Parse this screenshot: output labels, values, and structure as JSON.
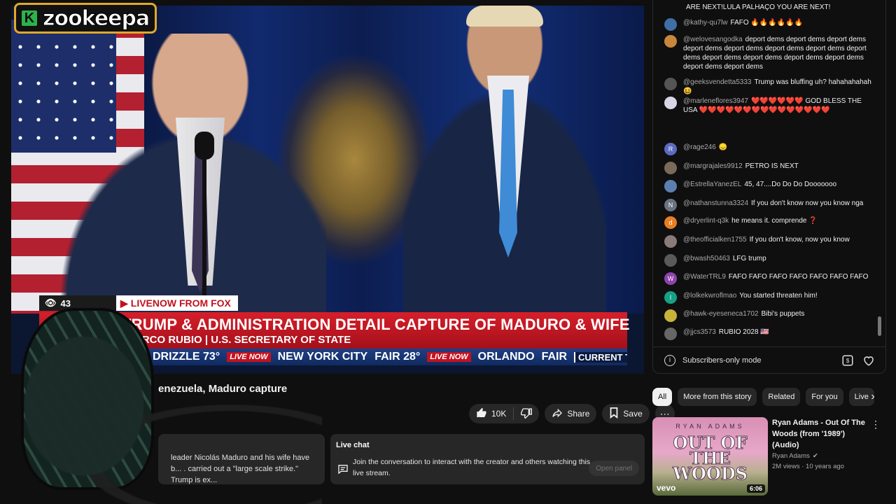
{
  "player": {
    "channel_logo": "zookeepa",
    "channel_logo_letter": "K",
    "viewer_count": "43",
    "tag": "LIVENOW FROM FOX",
    "headline": "TRUMP & ADMINISTRATION DETAIL CAPTURE OF MADURO & WIFE",
    "subheadline": "ARCO RUBIO | U.S. SECRETARY OF STATE",
    "ticker": {
      "w1": "DRIZZLE 73°",
      "live1": "LIVE NOW",
      "w2": "NEW YORK CITY",
      "w3": "FAIR 28°",
      "live2": "LIVE NOW",
      "w4": "ORLANDO",
      "w5": "FAIR",
      "temps": "CURRENT TEMPS"
    }
  },
  "video": {
    "title": "enezuela, Maduro capture",
    "like_count": "10K",
    "share_label": "Share",
    "save_label": "Save",
    "description": " leader Nicolás Maduro and his wife have b... . carried out a \"large scale strike.\" Trump is ex..."
  },
  "live_chat_panel": {
    "title": "Live chat",
    "message": "Join the conversation to interact with the creator and others watching this live stream.",
    "open_button": "Open panel"
  },
  "chat": {
    "messages": [
      {
        "user": "",
        "text": "ARE NEXT!LULA PALHAÇO YOU ARE NEXT!",
        "avatar": "",
        "color": "#0f0f0f"
      },
      {
        "user": "@kathy-qu7lw",
        "text": "FAFO 🔥🔥🔥🔥🔥🔥",
        "avatar": "",
        "color": "#3f6fa5"
      },
      {
        "user": "@welovesangodka",
        "text": "deport dems deport dems deport dems deport dems deport dems deport dems deport dems deport dems deport dems deport dems deport dems deport dems deport dems deport dems",
        "avatar": "",
        "color": "#c8873a"
      },
      {
        "user": "@geeksvendetta5333",
        "text": "Trump was bluffing uh? hahahahahah 😆",
        "avatar": "",
        "color": "#555555"
      },
      {
        "user": "@marleneflores3947",
        "text": "❤️❤️❤️❤️❤️❤️ GOD BLESS THE USA ❤️❤️❤️❤️❤️❤️❤️❤️❤️❤️❤️❤️❤️❤️❤️",
        "avatar": "",
        "color": "#d6d6e6"
      },
      {
        "user": "@rage246",
        "text": "😞",
        "avatar": "R",
        "color": "#5c6bc0"
      },
      {
        "user": "@margrajales9912",
        "text": "PETRO IS NEXT",
        "avatar": "",
        "color": "#7a6a5a"
      },
      {
        "user": "@EstrellaYanezEL",
        "text": "45, 47....Do Do Do Dooooooo",
        "avatar": "",
        "color": "#5d7fb0"
      },
      {
        "user": "@nathanstunna3324",
        "text": "If you don't know now you know nga",
        "avatar": "N",
        "color": "#6b7280"
      },
      {
        "user": "@dryerlint-q3k",
        "text": "he means it. comprende ❓",
        "avatar": "d",
        "color": "#e67e22"
      },
      {
        "user": "@theofficialken1755",
        "text": "If you don't know, now you know",
        "avatar": "",
        "color": "#8a7a7a"
      },
      {
        "user": "@bwash50463",
        "text": "LFG trump",
        "avatar": "",
        "color": "#5a5a5a"
      },
      {
        "user": "@WaterTRL9",
        "text": "FAFO FAFO FAFO FAFO FAFO FAFO FAFO",
        "avatar": "W",
        "color": "#8e44ad"
      },
      {
        "user": "@lolkekwroflmao",
        "text": "You started threaten him!",
        "avatar": "l",
        "color": "#16a085"
      },
      {
        "user": "@hawk-eyeseneca1702",
        "text": "Bibi's puppets",
        "avatar": "",
        "color": "#c9b23a"
      },
      {
        "user": "@jjcs3573",
        "text": "RUBIO 2028 🇺🇸",
        "avatar": "",
        "color": "#666666"
      }
    ],
    "footer_text": "Subscribers-only mode"
  },
  "filters": [
    "All",
    "More from this story",
    "Related",
    "For you",
    "Live"
  ],
  "recommendation": {
    "title": "Ryan Adams - Out Of The Woods (from '1989') (Audio)",
    "channel": "Ryan Adams",
    "views": "2M views · 10 years ago",
    "duration": "6:06",
    "thumb_top": "RYAN ADAMS",
    "thumb_title": "OUT OF THE WOODS",
    "thumb_brand": "vevo"
  }
}
